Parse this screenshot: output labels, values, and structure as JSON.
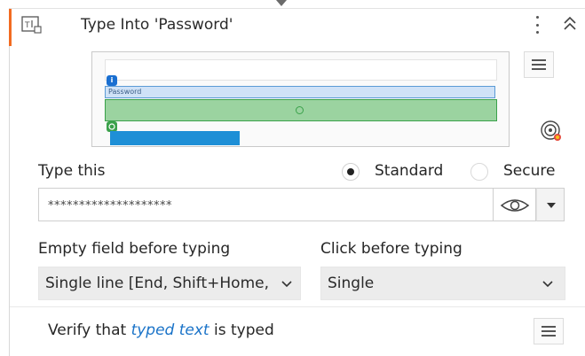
{
  "activity": {
    "title": "Type Into 'Password'",
    "icon": "type-into-icon"
  },
  "screenshot": {
    "password_label": "Password",
    "badge_anchor": "i",
    "accent_colors": {
      "anchor_blue": "#1a6fd1",
      "target_green": "#3aa14a",
      "card_accent": "#f26b21"
    }
  },
  "type_this": {
    "label": "Type this",
    "mode_options": [
      "Standard",
      "Secure"
    ],
    "selected_mode": "Standard",
    "value": "********************"
  },
  "empty_field": {
    "label": "Empty field before typing",
    "value": "Single line [End, Shift+Home, Del]"
  },
  "click_before": {
    "label": "Click before typing",
    "value": "Single"
  },
  "verify": {
    "prefix": "Verify that",
    "link": "typed text",
    "suffix": "is typed"
  }
}
